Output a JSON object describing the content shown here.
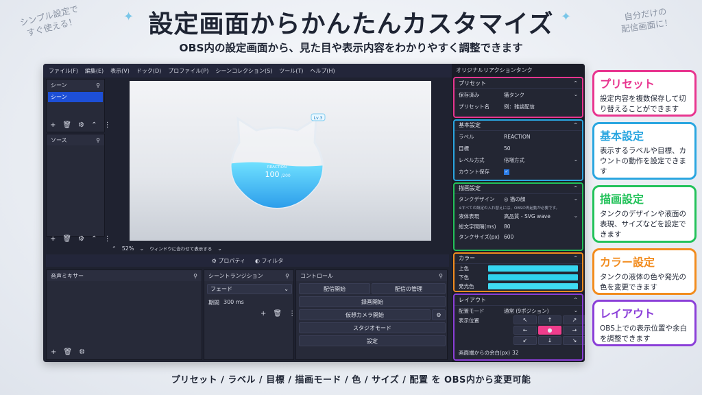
{
  "title": "設定画面からかんたんカスタマイズ",
  "subtitle": "OBS内の設定画面から、見た目や表示内容をわかりやすく調整できます",
  "note_left": [
    "シンプル設定で",
    "すぐ使える！"
  ],
  "note_right": [
    "自分だけの",
    "配信画面に！"
  ],
  "footer": "プリセット / ラベル / 目標 / 描画モード / 色 / サイズ / 配置 を OBS内から変更可能",
  "menubar": [
    "ファイル(F)",
    "編集(E)",
    "表示(V)",
    "ドック(D)",
    "プロファイル(P)",
    "シーンコレクション(S)",
    "ツール(T)",
    "ヘルプ(H)"
  ],
  "scenes": {
    "title": "シーン",
    "items": [
      "シーン"
    ]
  },
  "sources": {
    "title": "ソース"
  },
  "zoom": {
    "value": "52%",
    "fit_label": "ウィンドウに合わせて表示する"
  },
  "properties_label": "プロパティ",
  "filters_label": "フィルタ",
  "audio_mixer": {
    "title": "音声ミキサー"
  },
  "transition": {
    "title": "シーントランジション",
    "type": "フェード",
    "duration_label": "期間",
    "duration_value": "300 ms"
  },
  "controls": {
    "title": "コントロール",
    "start_stream": "配信開始",
    "manage_stream": "配信の管理",
    "start_recording": "録画開始",
    "virtual_camera": "仮想カメラ開始",
    "studio_mode": "スタジオモード",
    "settings": "設定"
  },
  "tank": {
    "level_badge": "Lv.3",
    "label": "REACTION",
    "count": "100",
    "target": "/200",
    "fill_fraction": 0.5
  },
  "settings_panel": {
    "title": "オリジナルリアクションタンク",
    "preset": {
      "header": "プリセット",
      "saved_label": "保存済み",
      "saved_value": "猫タンク",
      "name_label": "プリセット名",
      "name_placeholder": "例：雑談配信"
    },
    "basic": {
      "header": "基本設定",
      "label_label": "ラベル",
      "label_value": "REACTION",
      "target_label": "目標",
      "target_value": "50",
      "level_label": "レベル方式",
      "level_value": "倍増方式",
      "count_save_label": "カウント保存"
    },
    "render": {
      "header": "描画設定",
      "tank_design_label": "タンクデザイン",
      "tank_design_value": "◎ 猫の顔",
      "note": "※すべての設定の入れ替えには、OBSの再起動が必要です。",
      "liquid_label": "液体表現",
      "liquid_value": "高品質 - SVG wave",
      "interval_label": "総文字間隔(ms)",
      "interval_value": "80",
      "size_label": "タンクサイズ(px)",
      "size_value": "600"
    },
    "color": {
      "header": "カラー",
      "top_label": "上色",
      "bottom_label": "下色",
      "glow_label": "発光色",
      "top_color": "#35d6f0",
      "bottom_color": "#2fd2ee",
      "glow_color": "#3fdcf3"
    },
    "layout": {
      "header": "レイアウト",
      "mode_label": "配置モード",
      "mode_value": "通常 (9ポジション)",
      "pos_label": "表示位置",
      "margin_label": "画面端からの余白(px)",
      "margin_value": "32"
    }
  },
  "callouts": [
    {
      "title": "プリセット",
      "body": "設定内容を複数保存して切り替えることができます",
      "color": "#e8358f"
    },
    {
      "title": "基本設定",
      "body": "表示するラベルや目標、カウントの動作を設定できます",
      "color": "#2aa6e0"
    },
    {
      "title": "描画設定",
      "body": "タンクのデザインや液面の表現、サイズなどを設定できます",
      "color": "#23c25a"
    },
    {
      "title": "カラー設定",
      "body": "タンクの液体の色や発光の色を変更できます",
      "color": "#f28c1e"
    },
    {
      "title": "レイアウト",
      "body": "OBS上での表示位置や余白を調整できます",
      "color": "#8b3fd8"
    }
  ]
}
